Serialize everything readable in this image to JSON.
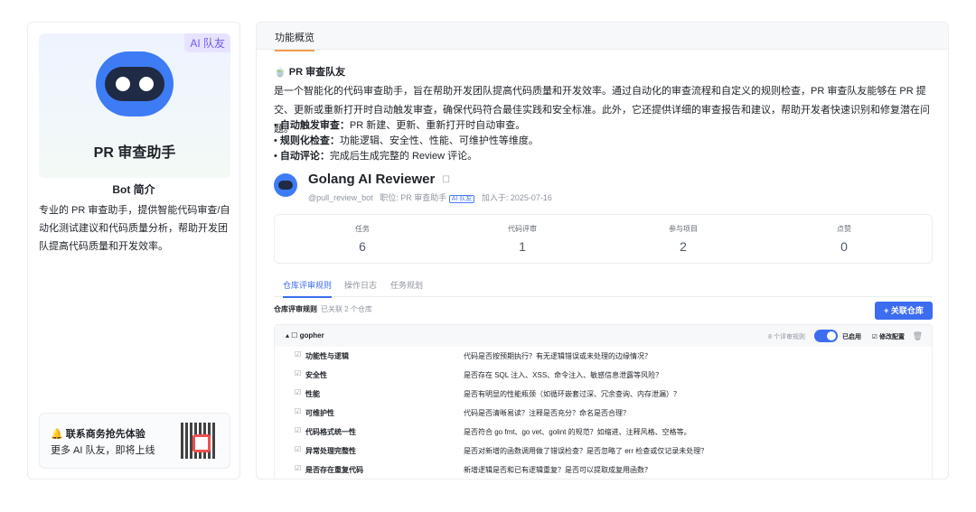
{
  "left": {
    "ai_badge": "AI 队友",
    "bot_name": "PR 审查助手",
    "intro_title": "Bot 简介",
    "intro_text": "专业的 PR 审查助手，提供智能代码审查/自动化测试建议和代码质量分析，帮助开发团队提高代码质量和开发效率。",
    "contact_title": "🔔 联系商务抢先体验",
    "contact_sub": "更多 AI 队友，即将上线"
  },
  "main": {
    "tab": "功能概览",
    "section_title": "🍵 PR 审查队友",
    "desc": "是一个智能化的代码审查助手，旨在帮助开发团队提高代码质量和开发效率。通过自动化的审查流程和自定义的规则检查，PR 审查队友能够在 PR 提交、更新或重新打开时自动触发审查，确保代码符合最佳实践和安全标准。此外，它还提供详细的审查报告和建议，帮助开发者快速识别和修复潜在问题。",
    "bullets": [
      {
        "label": "自动触发审查：",
        "text": "PR 新建、更新、重新打开时自动审查。"
      },
      {
        "label": "规则化检查：",
        "text": "功能逻辑、安全性、性能、可维护性等维度。"
      },
      {
        "label": "自动评论：",
        "text": "完成后生成完整的 Review 评论。"
      }
    ]
  },
  "reviewer": {
    "name": "Golang AI Reviewer",
    "handle": "@pull_review_bot",
    "role": "职位: PR 审查助手",
    "badge": "AI 队友",
    "joined": "加入于: 2025-07-16"
  },
  "stats": [
    {
      "label": "任务",
      "value": "6"
    },
    {
      "label": "代码评审",
      "value": "1"
    },
    {
      "label": "参与项目",
      "value": "2"
    },
    {
      "label": "点赞",
      "value": "0"
    }
  ],
  "subtabs": [
    "仓库评审规则",
    "操作日志",
    "任务规划"
  ],
  "rules_section": {
    "title": "仓库评审规则",
    "count": "已关联 2 个仓库",
    "link_button": "+ 关联仓库"
  },
  "repo": {
    "name": "▴ ☐ gopher",
    "rule_count": "8 个评审规则",
    "enabled": "已启用",
    "edit": "☑ 修改配置",
    "rules": [
      {
        "name": "功能性与逻辑",
        "desc": "代码是否按预期执行？有无逻辑错误或未处理的边缘情况？"
      },
      {
        "name": "安全性",
        "desc": "是否存在 SQL 注入、XSS、命令注入、敏感信息泄露等风险？"
      },
      {
        "name": "性能",
        "desc": "是否有明显的性能瓶颈（如循环嵌套过深、冗余查询、内存泄漏）？"
      },
      {
        "name": "可维护性",
        "desc": "代码是否清晰易读？注释是否充分？命名是否合理？"
      },
      {
        "name": "代码格式统一性",
        "desc": "是否符合 go fmt、go vet、golint 的规范？如缩进、注释风格、空格等。"
      },
      {
        "name": "异常处理完整性",
        "desc": "是否对新增的函数调用做了错误检查？是否忽略了 err 检查或仅记录未处理？"
      },
      {
        "name": "是否存在重复代码",
        "desc": "新增逻辑是否和已有逻辑重复？是否可以提取成复用函数？"
      }
    ]
  }
}
